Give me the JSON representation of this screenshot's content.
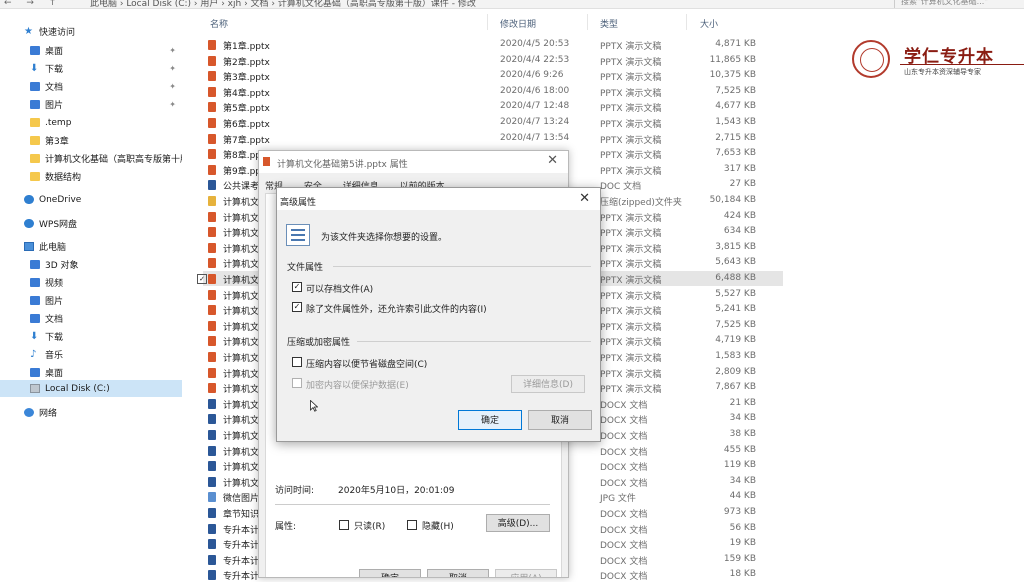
{
  "address_bar": {
    "nav_glyphs": "← → ↑",
    "breadcrumb": "此电脑 › Local Disk (C:) › 用户 › xjh › 文档 › 计算机文化基础（高职高专版第十版）课件 - 修改",
    "search_placeholder": "搜索\"计算机文化基础...\""
  },
  "nav": {
    "items": [
      {
        "label": "快速访问",
        "icon": "star-icon",
        "pinned": false
      },
      {
        "label": "桌面",
        "icon": "desktop-icon",
        "pinned": true
      },
      {
        "label": "下载",
        "icon": "download-icon",
        "pinned": true
      },
      {
        "label": "文档",
        "icon": "documents-icon",
        "pinned": true
      },
      {
        "label": "图片",
        "icon": "pictures-icon",
        "pinned": true
      },
      {
        "label": ".temp",
        "icon": "folder-icon",
        "pinned": false
      },
      {
        "label": "第3章",
        "icon": "folder-icon",
        "pinned": false
      },
      {
        "label": "计算机文化基础（高职高专版第十版",
        "icon": "folder-icon",
        "pinned": false
      },
      {
        "label": "数据结构",
        "icon": "folder-icon",
        "pinned": false
      },
      {
        "label": "OneDrive",
        "icon": "cloud-icon",
        "pinned": false
      },
      {
        "label": "WPS网盘",
        "icon": "wps-cloud-icon",
        "pinned": false
      },
      {
        "label": "此电脑",
        "icon": "computer-icon",
        "pinned": false
      },
      {
        "label": "3D 对象",
        "icon": "3d-objects-icon",
        "pinned": false
      },
      {
        "label": "视频",
        "icon": "videos-icon",
        "pinned": false
      },
      {
        "label": "图片",
        "icon": "pictures-icon",
        "pinned": false
      },
      {
        "label": "文档",
        "icon": "documents-icon",
        "pinned": false
      },
      {
        "label": "下载",
        "icon": "download-icon",
        "pinned": false
      },
      {
        "label": "音乐",
        "icon": "music-icon",
        "pinned": false
      },
      {
        "label": "桌面",
        "icon": "desktop-icon",
        "pinned": false
      },
      {
        "label": "Local Disk (C:)",
        "icon": "disk-icon",
        "pinned": false,
        "selected": true
      },
      {
        "label": "网络",
        "icon": "network-icon",
        "pinned": false
      }
    ],
    "pin_glyph": "✦"
  },
  "list": {
    "headers": {
      "name": "名称",
      "date": "修改日期",
      "type": "类型",
      "size": "大小"
    },
    "rows": [
      {
        "name": "第1章.pptx",
        "date": "2020/4/5 20:53",
        "type": "PPTX 演示文稿",
        "size": "4,871 KB",
        "kind": "ppt"
      },
      {
        "name": "第2章.pptx",
        "date": "2020/4/4 22:53",
        "type": "PPTX 演示文稿",
        "size": "11,865 KB",
        "kind": "ppt"
      },
      {
        "name": "第3章.pptx",
        "date": "2020/4/6 9:26",
        "type": "PPTX 演示文稿",
        "size": "10,375 KB",
        "kind": "ppt"
      },
      {
        "name": "第4章.pptx",
        "date": "2020/4/6 18:00",
        "type": "PPTX 演示文稿",
        "size": "7,525 KB",
        "kind": "ppt"
      },
      {
        "name": "第5章.pptx",
        "date": "2020/4/7 12:48",
        "type": "PPTX 演示文稿",
        "size": "4,677 KB",
        "kind": "ppt"
      },
      {
        "name": "第6章.pptx",
        "date": "2020/4/7 13:24",
        "type": "PPTX 演示文稿",
        "size": "1,543 KB",
        "kind": "ppt"
      },
      {
        "name": "第7章.pptx",
        "date": "2020/4/7 13:54",
        "type": "PPTX 演示文稿",
        "size": "2,715 KB",
        "kind": "ppt"
      },
      {
        "name": "第8章.pp",
        "date": "",
        "type": "PPTX 演示文稿",
        "size": "7,653 KB",
        "kind": "ppt"
      },
      {
        "name": "第9章.pp",
        "date": "",
        "type": "PPTX 演示文稿",
        "size": "317 KB",
        "kind": "ppt"
      },
      {
        "name": "公共课考",
        "date": "",
        "type": "DOC 文档",
        "size": "27 KB",
        "kind": "doc"
      },
      {
        "name": "计算机文",
        "date": "",
        "type": "压缩(zipped)文件夹",
        "size": "50,184 KB",
        "kind": "zip"
      },
      {
        "name": "计算机文",
        "date": "",
        "type": "PPTX 演示文稿",
        "size": "424 KB",
        "kind": "ppt"
      },
      {
        "name": "计算机文",
        "date": "",
        "type": "PPTX 演示文稿",
        "size": "634 KB",
        "kind": "ppt"
      },
      {
        "name": "计算机文",
        "date": "",
        "type": "PPTX 演示文稿",
        "size": "3,815 KB",
        "kind": "ppt"
      },
      {
        "name": "计算机文",
        "date": "",
        "type": "PPTX 演示文稿",
        "size": "5,643 KB",
        "kind": "ppt"
      },
      {
        "name": "计算机文",
        "date": "",
        "type": "PPTX 演示文稿",
        "size": "6,488 KB",
        "kind": "ppt",
        "selected": true
      },
      {
        "name": "计算机文",
        "date": "",
        "type": "PPTX 演示文稿",
        "size": "5,527 KB",
        "kind": "ppt"
      },
      {
        "name": "计算机文",
        "date": "",
        "type": "PPTX 演示文稿",
        "size": "5,241 KB",
        "kind": "ppt"
      },
      {
        "name": "计算机文",
        "date": "",
        "type": "PPTX 演示文稿",
        "size": "7,525 KB",
        "kind": "ppt"
      },
      {
        "name": "计算机文",
        "date": "",
        "type": "PPTX 演示文稿",
        "size": "4,719 KB",
        "kind": "ppt"
      },
      {
        "name": "计算机文",
        "date": "",
        "type": "PPTX 演示文稿",
        "size": "1,583 KB",
        "kind": "ppt"
      },
      {
        "name": "计算机文",
        "date": "",
        "type": "PPTX 演示文稿",
        "size": "2,809 KB",
        "kind": "ppt"
      },
      {
        "name": "计算机文",
        "date": "",
        "type": "PPTX 演示文稿",
        "size": "7,867 KB",
        "kind": "ppt"
      },
      {
        "name": "计算机文",
        "date": "",
        "type": "DOCX 文档",
        "size": "21 KB",
        "kind": "doc"
      },
      {
        "name": "计算机文",
        "date": "",
        "type": "DOCX 文档",
        "size": "34 KB",
        "kind": "doc"
      },
      {
        "name": "计算机文",
        "date": "",
        "type": "DOCX 文档",
        "size": "38 KB",
        "kind": "doc"
      },
      {
        "name": "计算机文",
        "date": "",
        "type": "DOCX 文档",
        "size": "455 KB",
        "kind": "doc"
      },
      {
        "name": "计算机文",
        "date": "",
        "type": "DOCX 文档",
        "size": "119 KB",
        "kind": "doc"
      },
      {
        "name": "计算机文",
        "date": "",
        "type": "DOCX 文档",
        "size": "34 KB",
        "kind": "doc"
      },
      {
        "name": "微信图片",
        "date": "",
        "type": "JPG 文件",
        "size": "44 KB",
        "kind": "jpg"
      },
      {
        "name": "章节知识",
        "date": "",
        "type": "DOCX 文档",
        "size": "973 KB",
        "kind": "doc"
      },
      {
        "name": "专升本计",
        "date": "",
        "type": "DOCX 文档",
        "size": "56 KB",
        "kind": "doc"
      },
      {
        "name": "专升本计",
        "date": "",
        "type": "DOCX 文档",
        "size": "19 KB",
        "kind": "doc"
      },
      {
        "name": "专升本计",
        "date": "",
        "type": "DOCX 文档",
        "size": "159 KB",
        "kind": "doc"
      },
      {
        "name": "专升本计",
        "date": "",
        "type": "DOCX 文档",
        "size": "18 KB",
        "kind": "doc"
      }
    ]
  },
  "logo": {
    "title": "学仁专升本",
    "subtitle": "山东专升本资深辅导专家"
  },
  "properties_dialog": {
    "title": "计算机文化基础第5讲.pptx 属性",
    "close_glyph": "✕",
    "tabs": [
      "常规",
      "安全",
      "详细信息",
      "以前的版本"
    ],
    "accessed_label": "访问时间:",
    "accessed_value": "2020年5月10日，20:01:09",
    "attributes_label": "属性:",
    "readonly_label": "只读(R)",
    "hidden_label": "隐藏(H)",
    "advanced_button": "高级(D)...",
    "ok_button": "确定",
    "cancel_button": "取消",
    "apply_button": "应用(A)"
  },
  "advanced_dialog": {
    "title": "高级属性",
    "close_glyph": "✕",
    "description": "为该文件夹选择你想要的设置。",
    "group_file_attrs": "文件属性",
    "archive_label": "可以存档文件(A)",
    "archive_checked": true,
    "index_label": "除了文件属性外，还允许索引此文件的内容(I)",
    "index_checked": true,
    "group_compress": "压缩或加密属性",
    "compress_label": "压缩内容以便节省磁盘空间(C)",
    "compress_checked": false,
    "encrypt_label": "加密内容以便保护数据(E)",
    "encrypt_checked": false,
    "details_button": "详细信息(D)",
    "ok_button": "确定",
    "cancel_button": "取消",
    "check_glyph": "✓"
  },
  "colors": {
    "accent": "#0078d7",
    "selection": "#cce4f7",
    "ppt": "#d7572b",
    "doc": "#2b5797",
    "logo_red": "#8a1c12"
  }
}
